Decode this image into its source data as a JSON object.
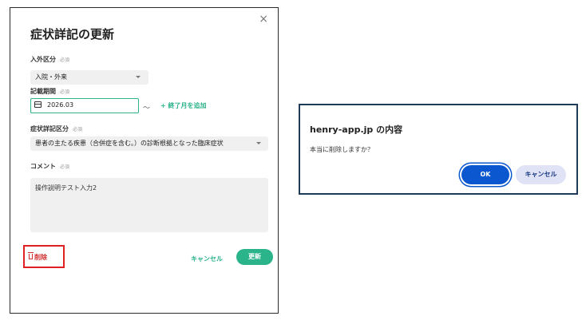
{
  "modal": {
    "title": "症状詳記の更新",
    "close_icon": "×",
    "required_tag": "必須",
    "in_out": {
      "label": "入外区分",
      "value": "入院・外来"
    },
    "period": {
      "label": "記載期間",
      "value": "2026.03",
      "tilde": "〜",
      "add_end_month": "+ 終了月を追加"
    },
    "category": {
      "label": "症状詳記区分",
      "value": "患者の主たる疾患（合併症を含む。）の診断根拠となった臨床症状"
    },
    "comment": {
      "label": "コメント",
      "value": "操作説明テスト入力2"
    },
    "buttons": {
      "delete": "削除",
      "cancel": "キャンセル",
      "update": "更新"
    },
    "colors": {
      "accent": "#2bb38a",
      "danger": "#d32f2f"
    }
  },
  "dialog": {
    "title": "henry-app.jp の内容",
    "message": "本当に削除しますか？",
    "ok": "OK",
    "cancel": "キャンセル",
    "colors": {
      "primary": "#0b57d0"
    }
  }
}
